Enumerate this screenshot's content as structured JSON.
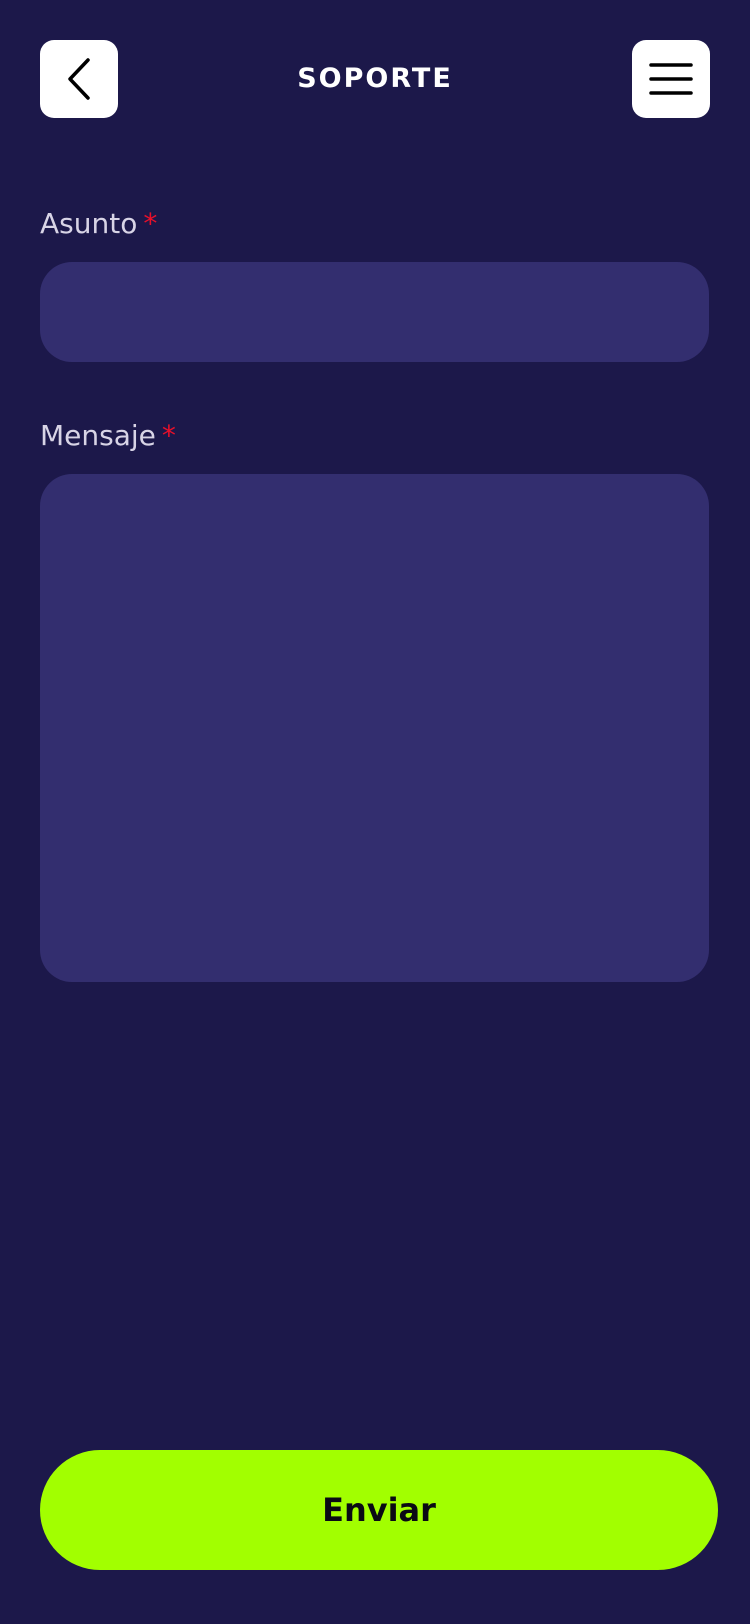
{
  "header": {
    "title": "SOPORTE",
    "back_icon": "chevron-left-icon",
    "menu_icon": "hamburger-menu-icon"
  },
  "form": {
    "subject_label": "Asunto",
    "subject_value": "",
    "message_label": "Mensaje",
    "message_value": "",
    "required_mark": "*"
  },
  "submit_label": "Enviar",
  "colors": {
    "background": "#1c184a",
    "input_background": "#332e6f",
    "accent": "#a2ff00",
    "required": "#e8102a"
  }
}
